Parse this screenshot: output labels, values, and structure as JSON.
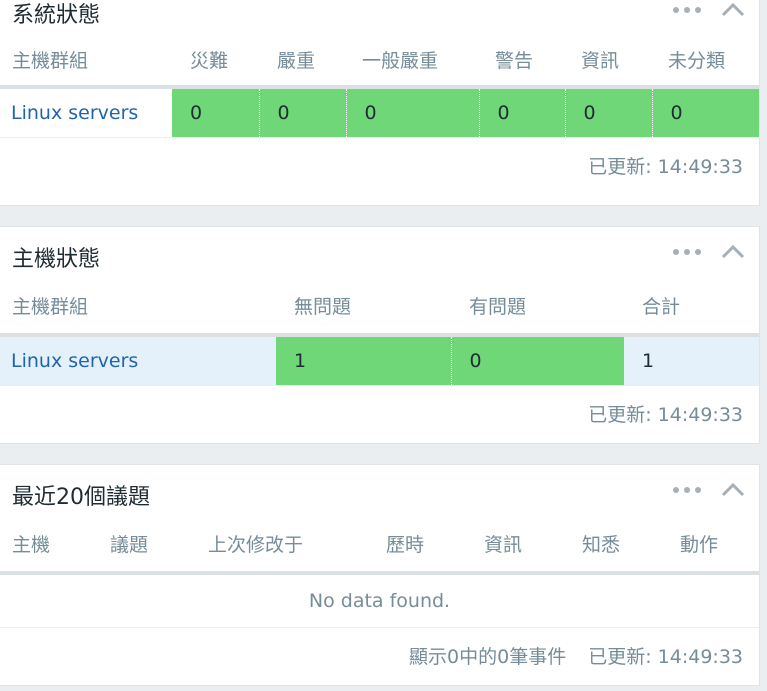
{
  "widgets": {
    "system_status": {
      "title": "系統狀態",
      "columns": [
        "主機群組",
        "災難",
        "嚴重",
        "一般嚴重",
        "警告",
        "資訊",
        "未分類"
      ],
      "rows": [
        {
          "group": "Linux servers",
          "values": [
            "0",
            "0",
            "0",
            "0",
            "0",
            "0"
          ]
        }
      ],
      "updated": "已更新: 14:49:33"
    },
    "host_status": {
      "title": "主機狀態",
      "columns": [
        "主機群組",
        "無問題",
        "有問題",
        "合計"
      ],
      "rows": [
        {
          "group": "Linux servers",
          "values": [
            "1",
            "0",
            "1"
          ]
        }
      ],
      "updated": "已更新: 14:49:33"
    },
    "recent_issues": {
      "title": "最近20個議題",
      "columns": [
        "主機",
        "議題",
        "上次修改于",
        "歷時",
        "資訊",
        "知悉",
        "動作"
      ],
      "empty_text": "No data found.",
      "count_text": "顯示0中的0筆事件",
      "updated": "已更新: 14:49:33"
    }
  },
  "colors": {
    "ok_green": "#6fd778",
    "link_blue": "#1f65ad",
    "row_highlight": "#e4f0fa",
    "muted_text": "#768d99"
  },
  "icons": [
    "more-dots-icon",
    "chevron-up-icon"
  ]
}
